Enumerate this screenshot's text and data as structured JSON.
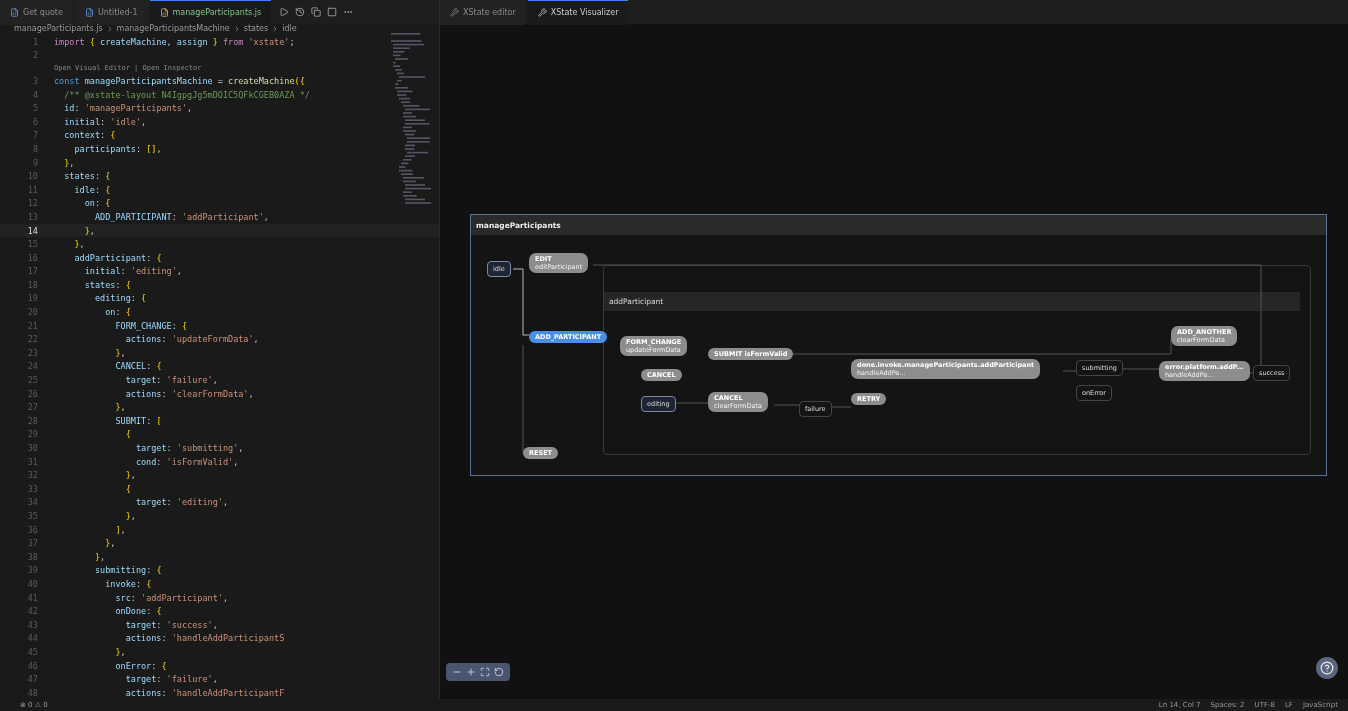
{
  "editor_tabs": [
    {
      "label": "Get quote",
      "selected": false
    },
    {
      "label": "Untitled-1",
      "selected": false
    },
    {
      "label": "manageParticipants.js",
      "selected": true
    }
  ],
  "panel_tabs": [
    {
      "label": "XState editor",
      "selected": false
    },
    {
      "label": "XState Visualizer",
      "selected": true
    }
  ],
  "breadcrumb": [
    "manageParticipants.js",
    "manageParticipantsMachine",
    "states",
    "idle"
  ],
  "code_lines": [
    {
      "number": "1",
      "current": false,
      "tokens": [
        {
          "kind": "kw",
          "text": "import "
        },
        {
          "kind": "br",
          "text": "{"
        },
        {
          "kind": "v",
          "text": " createMachine, assign "
        },
        {
          "kind": "br",
          "text": "}"
        },
        {
          "kind": "kw",
          "text": " from "
        },
        {
          "kind": "s",
          "text": "'xstate'"
        },
        {
          "kind": "p",
          "text": ";"
        }
      ]
    },
    {
      "number": "2",
      "current": false
    },
    {
      "number": "3",
      "current": false,
      "lens": "Open Visual Editor | Open Inspector",
      "tokens": [
        {
          "kind": "c2",
          "text": "const"
        },
        {
          "kind": "v",
          "text": " manageParticipantsMachine"
        },
        {
          "kind": "p",
          "text": " = "
        },
        {
          "kind": "f",
          "text": "createMachine"
        },
        {
          "kind": "br",
          "text": "({"
        }
      ]
    },
    {
      "number": "4",
      "current": false,
      "tokens": [
        {
          "kind": "cm",
          "text": "  /** @xstate-layout N4IgpgJg5mDOIC5QFkCGEB0AZA */"
        }
      ]
    },
    {
      "number": "5",
      "current": false,
      "tokens": [
        {
          "kind": "v",
          "text": "  id"
        },
        {
          "kind": "p",
          "text": ": "
        },
        {
          "kind": "s",
          "text": "'manageParticipants'"
        },
        {
          "kind": "p",
          "text": ","
        }
      ]
    },
    {
      "number": "6",
      "current": false,
      "tokens": [
        {
          "kind": "v",
          "text": "  initial"
        },
        {
          "kind": "p",
          "text": ": "
        },
        {
          "kind": "s",
          "text": "'idle'"
        },
        {
          "kind": "p",
          "text": ","
        }
      ]
    },
    {
      "number": "7",
      "current": false,
      "tokens": [
        {
          "kind": "v",
          "text": "  context"
        },
        {
          "kind": "p",
          "text": ": "
        },
        {
          "kind": "br",
          "text": "{"
        }
      ]
    },
    {
      "number": "8",
      "current": false,
      "tokens": [
        {
          "kind": "v",
          "text": "    participants"
        },
        {
          "kind": "p",
          "text": ": "
        },
        {
          "kind": "br",
          "text": "[]"
        },
        {
          "kind": "p",
          "text": ","
        }
      ]
    },
    {
      "number": "9",
      "current": false,
      "tokens": [
        {
          "kind": "br",
          "text": "  }"
        },
        {
          "kind": "p",
          "text": ","
        }
      ]
    },
    {
      "number": "10",
      "current": false,
      "tokens": [
        {
          "kind": "v",
          "text": "  states"
        },
        {
          "kind": "p",
          "text": ": "
        },
        {
          "kind": "br",
          "text": "{"
        }
      ]
    },
    {
      "number": "11",
      "current": false,
      "tokens": [
        {
          "kind": "v",
          "text": "    idle"
        },
        {
          "kind": "p",
          "text": ": "
        },
        {
          "kind": "br",
          "text": "{"
        }
      ]
    },
    {
      "number": "12",
      "current": false,
      "tokens": [
        {
          "kind": "v",
          "text": "      on"
        },
        {
          "kind": "p",
          "text": ": "
        },
        {
          "kind": "br",
          "text": "{"
        }
      ]
    },
    {
      "number": "13",
      "current": false,
      "tokens": [
        {
          "kind": "v",
          "text": "        ADD_PARTICIPANT"
        },
        {
          "kind": "p",
          "text": ": "
        },
        {
          "kind": "s",
          "text": "'addParticipant'"
        },
        {
          "kind": "p",
          "text": ","
        }
      ]
    },
    {
      "number": "14",
      "current": true,
      "tokens": [
        {
          "kind": "br",
          "text": "      }"
        },
        {
          "kind": "p",
          "text": ","
        }
      ]
    },
    {
      "number": "15",
      "current": false,
      "tokens": [
        {
          "kind": "br",
          "text": "    }"
        },
        {
          "kind": "p",
          "text": ","
        }
      ]
    },
    {
      "number": "16",
      "current": false,
      "tokens": [
        {
          "kind": "v",
          "text": "    addParticipant"
        },
        {
          "kind": "p",
          "text": ": "
        },
        {
          "kind": "br",
          "text": "{"
        }
      ]
    },
    {
      "number": "17",
      "current": false,
      "tokens": [
        {
          "kind": "v",
          "text": "      initial"
        },
        {
          "kind": "p",
          "text": ": "
        },
        {
          "kind": "s",
          "text": "'editing'"
        },
        {
          "kind": "p",
          "text": ","
        }
      ]
    },
    {
      "number": "18",
      "current": false,
      "tokens": [
        {
          "kind": "v",
          "text": "      states"
        },
        {
          "kind": "p",
          "text": ": "
        },
        {
          "kind": "br",
          "text": "{"
        }
      ]
    },
    {
      "number": "19",
      "current": false,
      "tokens": [
        {
          "kind": "v",
          "text": "        editing"
        },
        {
          "kind": "p",
          "text": ": "
        },
        {
          "kind": "br",
          "text": "{"
        }
      ]
    },
    {
      "number": "20",
      "current": false,
      "tokens": [
        {
          "kind": "v",
          "text": "          on"
        },
        {
          "kind": "p",
          "text": ": "
        },
        {
          "kind": "br",
          "text": "{"
        }
      ]
    },
    {
      "number": "21",
      "current": false,
      "tokens": [
        {
          "kind": "v",
          "text": "            FORM_CHANGE"
        },
        {
          "kind": "p",
          "text": ": "
        },
        {
          "kind": "br",
          "text": "{"
        }
      ]
    },
    {
      "number": "22",
      "current": false,
      "tokens": [
        {
          "kind": "v",
          "text": "              actions"
        },
        {
          "kind": "p",
          "text": ": "
        },
        {
          "kind": "s",
          "text": "'updateFormData'"
        },
        {
          "kind": "p",
          "text": ","
        }
      ]
    },
    {
      "number": "23",
      "current": false,
      "tokens": [
        {
          "kind": "br",
          "text": "            }"
        },
        {
          "kind": "p",
          "text": ","
        }
      ]
    },
    {
      "number": "24",
      "current": false,
      "tokens": [
        {
          "kind": "v",
          "text": "            CANCEL"
        },
        {
          "kind": "p",
          "text": ": "
        },
        {
          "kind": "br",
          "text": "{"
        }
      ]
    },
    {
      "number": "25",
      "current": false,
      "tokens": [
        {
          "kind": "v",
          "text": "              target"
        },
        {
          "kind": "p",
          "text": ": "
        },
        {
          "kind": "s",
          "text": "'failure'"
        },
        {
          "kind": "p",
          "text": ","
        }
      ]
    },
    {
      "number": "26",
      "current": false,
      "tokens": [
        {
          "kind": "v",
          "text": "              actions"
        },
        {
          "kind": "p",
          "text": ": "
        },
        {
          "kind": "s",
          "text": "'clearFormData'"
        },
        {
          "kind": "p",
          "text": ","
        }
      ]
    },
    {
      "number": "27",
      "current": false,
      "tokens": [
        {
          "kind": "br",
          "text": "            }"
        },
        {
          "kind": "p",
          "text": ","
        }
      ]
    },
    {
      "number": "28",
      "current": false,
      "tokens": [
        {
          "kind": "v",
          "text": "            SUBMIT"
        },
        {
          "kind": "p",
          "text": ": "
        },
        {
          "kind": "br",
          "text": "["
        }
      ]
    },
    {
      "number": "29",
      "current": false,
      "tokens": [
        {
          "kind": "br",
          "text": "              {"
        }
      ]
    },
    {
      "number": "30",
      "current": false,
      "tokens": [
        {
          "kind": "v",
          "text": "                target"
        },
        {
          "kind": "p",
          "text": ": "
        },
        {
          "kind": "s",
          "text": "'submitting'"
        },
        {
          "kind": "p",
          "text": ","
        }
      ]
    },
    {
      "number": "31",
      "current": false,
      "tokens": [
        {
          "kind": "v",
          "text": "                cond"
        },
        {
          "kind": "p",
          "text": ": "
        },
        {
          "kind": "s",
          "text": "'isFormValid'"
        },
        {
          "kind": "p",
          "text": ","
        }
      ]
    },
    {
      "number": "32",
      "current": false,
      "tokens": [
        {
          "kind": "br",
          "text": "              }"
        },
        {
          "kind": "p",
          "text": ","
        }
      ]
    },
    {
      "number": "33",
      "current": false,
      "tokens": [
        {
          "kind": "br",
          "text": "              {"
        }
      ]
    },
    {
      "number": "34",
      "current": false,
      "tokens": [
        {
          "kind": "v",
          "text": "                target"
        },
        {
          "kind": "p",
          "text": ": "
        },
        {
          "kind": "s",
          "text": "'editing'"
        },
        {
          "kind": "p",
          "text": ","
        }
      ]
    },
    {
      "number": "35",
      "current": false,
      "tokens": [
        {
          "kind": "br",
          "text": "              }"
        },
        {
          "kind": "p",
          "text": ","
        }
      ]
    },
    {
      "number": "36",
      "current": false,
      "tokens": [
        {
          "kind": "br",
          "text": "            ]"
        },
        {
          "kind": "p",
          "text": ","
        }
      ]
    },
    {
      "number": "37",
      "current": false,
      "tokens": [
        {
          "kind": "br",
          "text": "          }"
        },
        {
          "kind": "p",
          "text": ","
        }
      ]
    },
    {
      "number": "38",
      "current": false,
      "tokens": [
        {
          "kind": "br",
          "text": "        }"
        },
        {
          "kind": "p",
          "text": ","
        }
      ]
    },
    {
      "number": "39",
      "current": false,
      "tokens": [
        {
          "kind": "v",
          "text": "        submitting"
        },
        {
          "kind": "p",
          "text": ": "
        },
        {
          "kind": "br",
          "text": "{"
        }
      ]
    },
    {
      "number": "40",
      "current": false,
      "tokens": [
        {
          "kind": "v",
          "text": "          invoke"
        },
        {
          "kind": "p",
          "text": ": "
        },
        {
          "kind": "br",
          "text": "{"
        }
      ]
    },
    {
      "number": "41",
      "current": false,
      "tokens": [
        {
          "kind": "v",
          "text": "            src"
        },
        {
          "kind": "p",
          "text": ": "
        },
        {
          "kind": "s",
          "text": "'addParticipant'"
        },
        {
          "kind": "p",
          "text": ","
        }
      ]
    },
    {
      "number": "42",
      "current": false,
      "tokens": [
        {
          "kind": "v",
          "text": "            onDone"
        },
        {
          "kind": "p",
          "text": ": "
        },
        {
          "kind": "br",
          "text": "{"
        }
      ]
    },
    {
      "number": "43",
      "current": false,
      "tokens": [
        {
          "kind": "v",
          "text": "              target"
        },
        {
          "kind": "p",
          "text": ": "
        },
        {
          "kind": "s",
          "text": "'success'"
        },
        {
          "kind": "p",
          "text": ","
        }
      ]
    },
    {
      "number": "44",
      "current": false,
      "tokens": [
        {
          "kind": "v",
          "text": "              actions"
        },
        {
          "kind": "p",
          "text": ": "
        },
        {
          "kind": "s",
          "text": "'handleAddParticipantS"
        }
      ]
    },
    {
      "number": "45",
      "current": false,
      "tokens": [
        {
          "kind": "br",
          "text": "            }"
        },
        {
          "kind": "p",
          "text": ","
        }
      ]
    },
    {
      "number": "46",
      "current": false,
      "tokens": [
        {
          "kind": "v",
          "text": "            onError"
        },
        {
          "kind": "p",
          "text": ": "
        },
        {
          "kind": "br",
          "text": "{"
        }
      ]
    },
    {
      "number": "47",
      "current": false,
      "tokens": [
        {
          "kind": "v",
          "text": "              target"
        },
        {
          "kind": "p",
          "text": ": "
        },
        {
          "kind": "s",
          "text": "'failure'"
        },
        {
          "kind": "p",
          "text": ","
        }
      ]
    },
    {
      "number": "48",
      "current": false,
      "tokens": [
        {
          "kind": "v",
          "text": "              actions"
        },
        {
          "kind": "p",
          "text": ": "
        },
        {
          "kind": "s",
          "text": "'handleAddParticipantF"
        }
      ]
    }
  ],
  "machine": {
    "title": "manageParticipants",
    "compound_title": "addParticipant",
    "nodes": [
      {
        "kind": "state",
        "label": "idle",
        "initial": true
      },
      {
        "kind": "event",
        "label": "EDIT",
        "action": "editParticipant",
        "active": false
      },
      {
        "kind": "event",
        "label": "ADD_PARTICIPANT",
        "active": true
      },
      {
        "kind": "event",
        "label": "FORM_CHANGE",
        "action": "updateFormData",
        "active": false
      },
      {
        "kind": "event",
        "label": "CANCEL",
        "active": false
      },
      {
        "kind": "state",
        "label": "editing",
        "initial": true
      },
      {
        "kind": "event",
        "label": "SUBMIT  isFormValid",
        "active": false
      },
      {
        "kind": "event",
        "label": "CANCEL",
        "action": "clearFormData",
        "active": false
      },
      {
        "kind": "state",
        "label": "failure",
        "initial": false
      },
      {
        "kind": "event",
        "label": "done.invoke.manageParticipants.addParticipant",
        "action": "handleAddPa...",
        "active": false
      },
      {
        "kind": "event",
        "label": "RETRY",
        "active": false
      },
      {
        "kind": "state",
        "label": "submitting",
        "initial": false
      },
      {
        "kind": "state",
        "label": "onError",
        "initial": false
      },
      {
        "kind": "event",
        "label": "ADD_ANOTHER",
        "action": "clearFormData",
        "active": false
      },
      {
        "kind": "event",
        "label": "error.platform.addP...",
        "action": "handleAddPa...",
        "active": false
      },
      {
        "kind": "state",
        "label": "success",
        "initial": false
      },
      {
        "kind": "event",
        "label": "RESET",
        "active": false
      }
    ]
  },
  "status_left": "⊗ 0  ⚠ 0",
  "status_right": [
    "Ln 14, Col 7",
    "Spaces: 2",
    "UTF-8",
    "LF",
    "JavaScript"
  ]
}
